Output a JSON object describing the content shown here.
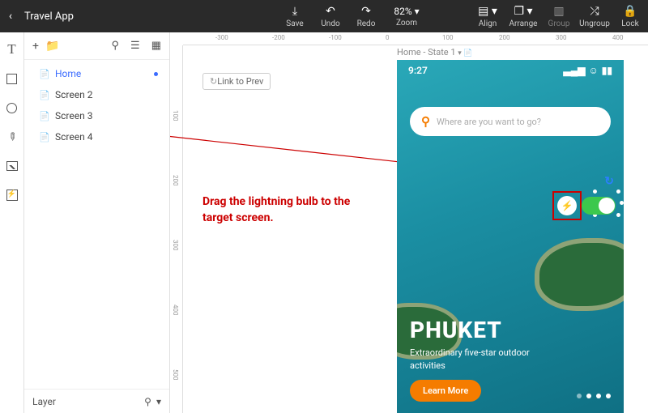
{
  "header": {
    "title": "Travel App",
    "tools": {
      "save": "Save",
      "undo": "Undo",
      "redo": "Redo",
      "zoom_value": "82%",
      "zoom_label": "Zoom",
      "align": "Align",
      "arrange": "Arrange",
      "group": "Group",
      "ungroup": "Ungroup",
      "lock": "Lock"
    }
  },
  "sidebar": {
    "items": [
      {
        "label": "Home",
        "selected": true
      },
      {
        "label": "Screen 2",
        "selected": false
      },
      {
        "label": "Screen 3",
        "selected": false
      },
      {
        "label": "Screen 4",
        "selected": false
      }
    ],
    "footer": "Layer"
  },
  "canvas": {
    "state_label": "Home - State 1",
    "link_prev": "Link to Prev",
    "ruler_h": [
      "-300",
      "-200",
      "-100",
      "0",
      "100",
      "200",
      "300",
      "400"
    ],
    "ruler_v": [
      "100",
      "200",
      "300",
      "400",
      "500"
    ],
    "annotation": "Drag the lightning bulb to the target screen."
  },
  "mockup": {
    "time": "9:27",
    "search_placeholder": "Where are you want to go?",
    "hero_title": "PHUKET",
    "hero_sub": "Extraordinary five-star outdoor activities",
    "cta": "Learn More"
  }
}
